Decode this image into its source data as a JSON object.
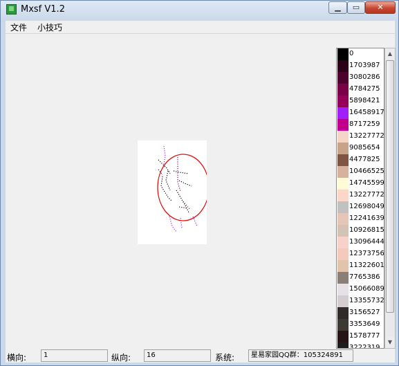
{
  "window": {
    "title": "Mxsf V1.2",
    "min_icon": "minimize-icon",
    "max_icon": "maximize-icon",
    "close_icon": "close-icon"
  },
  "menu": {
    "items": [
      "文件",
      "小技巧"
    ]
  },
  "palette": [
    {
      "color": "#000000",
      "value": "0"
    },
    {
      "color": "#2b0019",
      "value": "1703987"
    },
    {
      "color": "#4e002f",
      "value": "3080286"
    },
    {
      "color": "#7a0048",
      "value": "4784275"
    },
    {
      "color": "#950059",
      "value": "5898421"
    },
    {
      "color": "#a11ffb",
      "value": "16458917"
    },
    {
      "color": "#c0008a",
      "value": "8717259"
    },
    {
      "color": "#f4d6c9",
      "value": "13227772"
    },
    {
      "color": "#c9a28a",
      "value": "9085654"
    },
    {
      "color": "#7f5444",
      "value": "4477825"
    },
    {
      "color": "#d7b09f",
      "value": "10466525"
    },
    {
      "color": "#fffbd7",
      "value": "14745599"
    },
    {
      "color": "#fcd6c9",
      "value": "13227772"
    },
    {
      "color": "#c1c1c1",
      "value": "12698049"
    },
    {
      "color": "#e7c6ba",
      "value": "12241639"
    },
    {
      "color": "#d5c2b6",
      "value": "10926815"
    },
    {
      "color": "#f8d1c9",
      "value": "13096444"
    },
    {
      "color": "#f3cabc",
      "value": "12373756"
    },
    {
      "color": "#e0c5ac",
      "value": "11322601"
    },
    {
      "color": "#8a7e76",
      "value": "7765386"
    },
    {
      "color": "#e5e1e5",
      "value": "15066089"
    },
    {
      "color": "#d4ccd1",
      "value": "13355732"
    },
    {
      "color": "#302a2b",
      "value": "3156527"
    },
    {
      "color": "#3d3a34",
      "value": "3353649"
    },
    {
      "color": "#261418",
      "value": "1578777"
    },
    {
      "color": "#1d1d1d",
      "value": "3222319"
    }
  ],
  "status": {
    "horizontal_label": "横向:",
    "horizontal_value": "1",
    "vertical_label": "纵向:",
    "vertical_value": "16",
    "system_label": "系统:",
    "system_value": "星易家园QQ群：105324891"
  }
}
